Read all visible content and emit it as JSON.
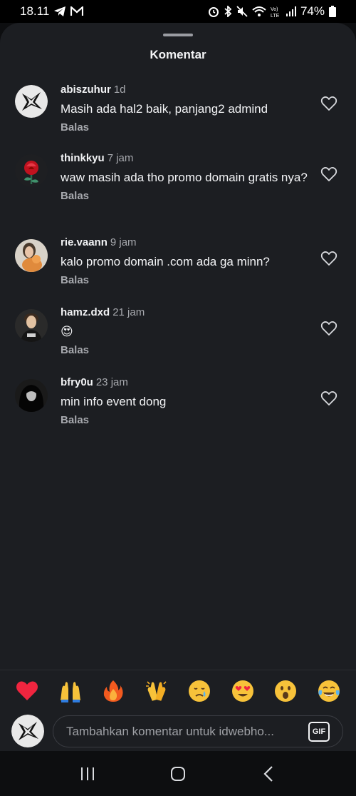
{
  "status_bar": {
    "time": "18.11",
    "battery": "74%",
    "icons": [
      "telegram-icon",
      "gmail-icon",
      "alarm-icon",
      "bluetooth-icon",
      "mute-icon",
      "wifi-icon",
      "volte-icon",
      "signal-icon",
      "battery-icon"
    ]
  },
  "sheet": {
    "title": "Komentar"
  },
  "comments": [
    {
      "user": "abiszuhur",
      "time": "1d",
      "text": "Masih ada hal2 baik, panjang2 admind",
      "reply": "Balas"
    },
    {
      "user": "thinkkyu",
      "time": "7 jam",
      "text": "waw masih ada tho promo domain gratis nya?",
      "reply": "Balas"
    },
    {
      "user": "rie.vaann",
      "time": "9 jam",
      "text": "kalo promo domain .com ada ga minn?",
      "reply": "Balas"
    },
    {
      "user": "hamz.dxd",
      "time": "21 jam",
      "text": "😍",
      "reply": "Balas"
    },
    {
      "user": "bfry0u",
      "time": "23 jam",
      "text": "min info event dong",
      "reply": "Balas"
    }
  ],
  "emoji_bar": [
    "red-heart",
    "raising-hands",
    "fire",
    "clapping-hands",
    "crying-face",
    "heart-eyes",
    "surprised-face",
    "tears-of-joy"
  ],
  "composer": {
    "placeholder": "Tambahkan komentar untuk idwebho...",
    "gif_label": "GIF"
  },
  "nav": [
    "recent-apps-icon",
    "home-icon",
    "back-icon"
  ],
  "colors": {
    "background": "#1c1e22",
    "text": "#f2f3f5",
    "muted": "#a7a9ae"
  }
}
